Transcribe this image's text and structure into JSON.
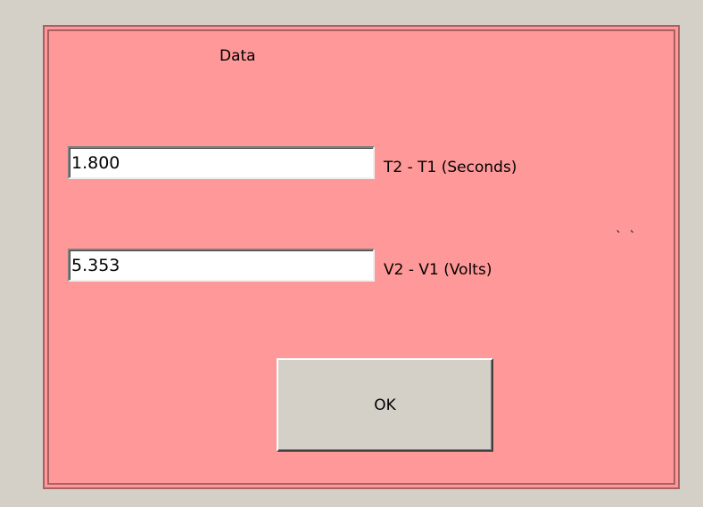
{
  "dialog": {
    "title": "Data",
    "fields": [
      {
        "value": "1.800",
        "label": "T2 - T1 (Seconds)"
      },
      {
        "value": "5.353",
        "label": "V2 - V1 (Volts)"
      }
    ],
    "stray_mark": "` `",
    "ok_label": "OK",
    "colors": {
      "background": "#ff9898",
      "border": "#a86060",
      "button_face": "#d4d0c8"
    }
  }
}
